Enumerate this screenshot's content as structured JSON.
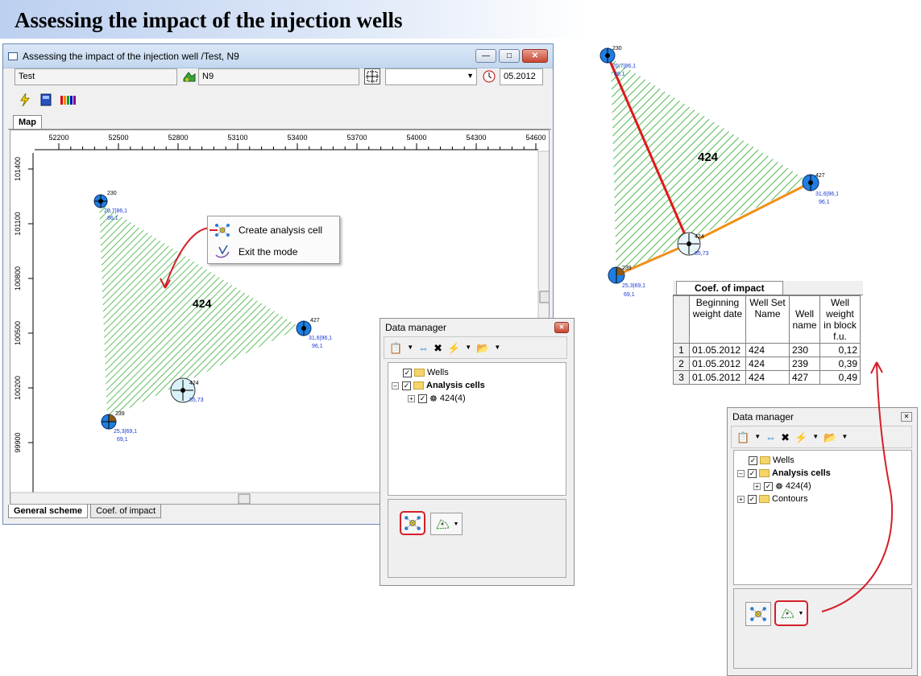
{
  "banner": {
    "title": "Assessing the impact of the injection wells"
  },
  "main_window": {
    "title": "Assessing the impact of the injection well /Test, N9",
    "fields": {
      "project": "Test",
      "layer": "N9",
      "date": "05.2012",
      "dropdown": ""
    },
    "tab_top": "Map",
    "x_ticks": [
      "52200",
      "52500",
      "52800",
      "53100",
      "53400",
      "53700",
      "54000",
      "54300",
      "54600"
    ],
    "y_ticks": [
      "101400",
      "101100",
      "100800",
      "100500",
      "100200",
      "99900"
    ],
    "bottom_tabs": [
      "General scheme",
      "Coef. of impact"
    ]
  },
  "wells_small": [
    {
      "id": "230",
      "label1": "20,7|86,1",
      "label2": "86,1"
    },
    {
      "id": "427",
      "label1": "31,6|96,1",
      "label2": "96,1"
    },
    {
      "id": "239",
      "label1": "25,3|69,1",
      "label2": "69,1"
    },
    {
      "id": "424",
      "label1": "85,73",
      "label2": ""
    }
  ],
  "cell_label": "424",
  "context_menu": {
    "items": [
      "Create analysis cell",
      "Exit the mode"
    ]
  },
  "data_manager": {
    "title": "Data manager",
    "tree": {
      "wells": "Wells",
      "analysis_cells": "Analysis cells",
      "cell": "424(4)",
      "contours": "Contours"
    }
  },
  "coef_table": {
    "tab": "Coef. of impact",
    "headers": [
      "Beginning weight date",
      "Well Set Name",
      "Well name",
      "Well weight in block f.u."
    ],
    "rows": [
      {
        "idx": "1",
        "date": "01.05.2012",
        "set": "424",
        "well": "230",
        "weight": "0,12"
      },
      {
        "idx": "2",
        "date": "01.05.2012",
        "set": "424",
        "well": "239",
        "weight": "0,39"
      },
      {
        "idx": "3",
        "date": "01.05.2012",
        "set": "424",
        "well": "427",
        "weight": "0,49"
      }
    ]
  },
  "colors": {
    "hatch": "#3ab03a",
    "well_blue": "#1f7fe0",
    "red_line": "#e01818",
    "orange_line": "#f0901a",
    "arrow": "#d4202a"
  }
}
